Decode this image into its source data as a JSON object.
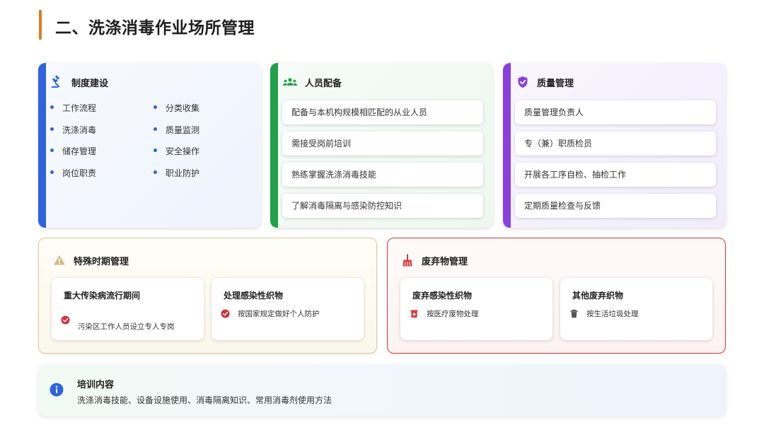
{
  "page": {
    "title": "二、洗涤消毒作业场所管理"
  },
  "system": {
    "title": "制度建设",
    "left_items": [
      "工作流程",
      "洗涤消毒",
      "储存管理",
      "岗位职责"
    ],
    "right_items": [
      "分类收集",
      "质量监测",
      "安全操作",
      "职业防护"
    ],
    "accent": "#2f63df",
    "icon": "gavel-icon"
  },
  "staff": {
    "title": "人员配备",
    "items": [
      "配备与本机构规模相匹配的从业人员",
      "需接受岗前培训",
      "熟练掌握洗涤消毒技能",
      "了解消毒隔离与感染防控知识"
    ],
    "accent": "#22a04b",
    "icon": "people-icon"
  },
  "quality": {
    "title": "质量管理",
    "items": [
      "质量管理负责人",
      "专（兼）职质检员",
      "开展各工序自检、抽检工作",
      "定期质量检查与反馈"
    ],
    "accent": "#8a3fe0",
    "icon": "shield-check-icon"
  },
  "special": {
    "title": "特殊时期管理",
    "icon": "warning-icon",
    "blocks": [
      {
        "title": "重大传染病流行期间",
        "text": "污染区工作人员设立专人专岗",
        "icon": "check-circle-icon"
      },
      {
        "title": "处理感染性织物",
        "text": "按国家规定做好个人防护",
        "icon": "check-circle-icon"
      }
    ]
  },
  "waste": {
    "title": "废弃物管理",
    "icon": "broom-icon",
    "accent": "#d23b3b",
    "blocks": [
      {
        "title": "废弃感染性织物",
        "text": "按医疗废物处理",
        "icon": "medical-bin-icon"
      },
      {
        "title": "其他废弃织物",
        "text": "按生活垃圾处理",
        "icon": "trash-icon"
      }
    ]
  },
  "training": {
    "title": "培训内容",
    "text": "洗涤消毒技能、设备设施使用、消毒隔离知识、常用消毒剂使用方法",
    "icon": "info-icon"
  }
}
